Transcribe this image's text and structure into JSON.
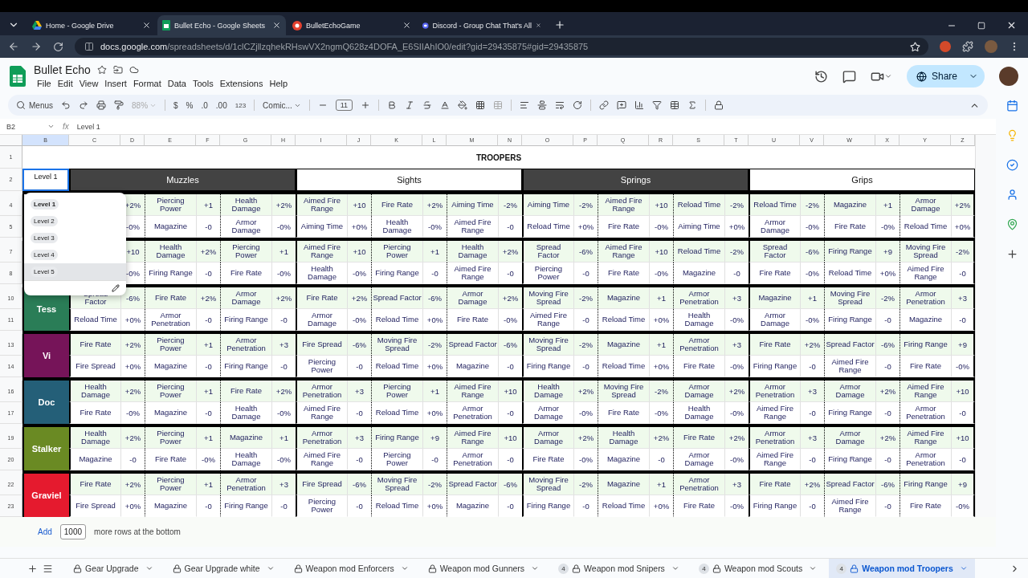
{
  "browser": {
    "tabs": [
      {
        "title": "Home - Google Drive",
        "kind": "drive",
        "selected": false
      },
      {
        "title": "Bullet Echo - Google Sheets",
        "kind": "sheets",
        "selected": true
      },
      {
        "title": "BulletEchoGame",
        "kind": "game",
        "selected": false
      },
      {
        "title": "Discord - Group Chat That's All",
        "kind": "discord",
        "selected": false
      }
    ],
    "url": {
      "host": "docs.google.com",
      "path": "/spreadsheets/d/1clCZjllzqhekRHswVX2ngmQ628z4DOFA_E6SIIAhIO0/edit?gid=29435875#gid=29435875"
    }
  },
  "doc": {
    "title": "Bullet Echo",
    "menus": [
      "File",
      "Edit",
      "View",
      "Insert",
      "Format",
      "Data",
      "Tools",
      "Extensions",
      "Help"
    ],
    "share": "Share"
  },
  "toolbar": {
    "search": "Menus",
    "zoom": "88%",
    "currency": "$",
    "percent": "%",
    "decrease_decimals": ".0",
    "increase_decimals": ".00",
    "number_format": "123",
    "font": "Comic...",
    "font_size": "11"
  },
  "formula_bar": {
    "cell_ref": "B2",
    "fx": "fx",
    "content": "Level 1"
  },
  "columns": [
    {
      "letter": "B",
      "selected": true
    },
    {
      "letter": "C",
      "selected": false
    },
    {
      "letter": "D",
      "selected": false
    },
    {
      "letter": "E",
      "selected": false
    },
    {
      "letter": "F",
      "selected": false
    },
    {
      "letter": "G",
      "selected": false
    },
    {
      "letter": "H",
      "selected": false
    },
    {
      "letter": "I",
      "selected": false
    },
    {
      "letter": "J",
      "selected": false
    },
    {
      "letter": "K",
      "selected": false
    },
    {
      "letter": "L",
      "selected": false
    },
    {
      "letter": "M",
      "selected": false
    },
    {
      "letter": "N",
      "selected": false
    },
    {
      "letter": "O",
      "selected": false
    },
    {
      "letter": "P",
      "selected": false
    },
    {
      "letter": "Q",
      "selected": false
    },
    {
      "letter": "R",
      "selected": false
    },
    {
      "letter": "S",
      "selected": false
    },
    {
      "letter": "T",
      "selected": false
    },
    {
      "letter": "U",
      "selected": false
    },
    {
      "letter": "V",
      "selected": false
    },
    {
      "letter": "W",
      "selected": false
    },
    {
      "letter": "X",
      "selected": false
    },
    {
      "letter": "Y",
      "selected": false
    },
    {
      "letter": "Z",
      "selected": false
    }
  ],
  "title_row": {
    "number": "1",
    "text": "TROOPERS"
  },
  "header_row": {
    "number": "2",
    "level_cell": "Level 1",
    "groups": [
      {
        "name": "Muzzles",
        "dark": true
      },
      {
        "name": "Sights",
        "dark": false
      },
      {
        "name": "Springs",
        "dark": true
      },
      {
        "name": "Grips",
        "dark": false
      }
    ]
  },
  "characters": [
    {
      "rows": [
        {
          "number": "4",
          "cells": [
            {
              "value": "+2%"
            },
            {
              "stat": "Piercing Power",
              "value": "+1"
            },
            {
              "stat": "Health Damage",
              "value": "+2%"
            },
            {
              "stat": "Aimed Fire Range",
              "value": "+10"
            },
            {
              "stat": "Fire Rate",
              "value": "+2%"
            },
            {
              "stat": "Aiming Time",
              "value": "-2%"
            },
            {
              "stat": "Aiming Time",
              "value": "-2%"
            },
            {
              "stat": "Aimed Fire Range",
              "value": "+10"
            },
            {
              "stat": "Reload Time",
              "value": "-2%"
            },
            {
              "stat": "Reload Time",
              "value": "-2%"
            },
            {
              "stat": "Magazine",
              "value": "+1"
            },
            {
              "stat": "Armor Damage",
              "value": "+2%"
            }
          ]
        },
        {
          "number": "5",
          "cells": [
            {
              "value": "-0%"
            },
            {
              "stat": "Magazine",
              "value": "-0"
            },
            {
              "stat": "Armor Damage",
              "value": "-0%"
            },
            {
              "stat": "Aiming Time",
              "value": "+0%"
            },
            {
              "stat": "Health Damage",
              "value": "-0%"
            },
            {
              "stat": "Aimed Fire Range",
              "value": "-0"
            },
            {
              "stat": "Reload Time",
              "value": "+0%"
            },
            {
              "stat": "Fire Rate",
              "value": "-0%"
            },
            {
              "stat": "Aiming Time",
              "value": "+0%"
            },
            {
              "stat": "Armor Damage",
              "value": "-0%"
            },
            {
              "stat": "Fire Rate",
              "value": "-0%"
            },
            {
              "stat": "Reload Time",
              "value": "+0%"
            }
          ]
        }
      ]
    },
    {
      "rows": [
        {
          "number": "7",
          "cells": [
            {
              "value": "+10"
            },
            {
              "stat": "Health Damage",
              "value": "+2%"
            },
            {
              "stat": "Piercing Power",
              "value": "+1"
            },
            {
              "stat": "Aimed Fire Range",
              "value": "+10"
            },
            {
              "stat": "Piercing Power",
              "value": "+1"
            },
            {
              "stat": "Health Damage",
              "value": "+2%"
            },
            {
              "stat": "Spread Factor",
              "value": "-6%"
            },
            {
              "stat": "Aimed Fire Range",
              "value": "+10"
            },
            {
              "stat": "Reload Time",
              "value": "-2%"
            },
            {
              "stat": "Spread Factor",
              "value": "-6%"
            },
            {
              "stat": "Firing Range",
              "value": "+9"
            },
            {
              "stat": "Moving Fire Spread",
              "value": "-2%"
            }
          ]
        },
        {
          "number": "8",
          "cells": [
            {
              "value": "-0%"
            },
            {
              "stat": "Firing Range",
              "value": "-0"
            },
            {
              "stat": "Fire Rate",
              "value": "-0%"
            },
            {
              "stat": "Health Damage",
              "value": "-0%"
            },
            {
              "stat": "Firing Range",
              "value": "-0"
            },
            {
              "stat": "Aimed Fire Range",
              "value": "-0"
            },
            {
              "stat": "Piercing Power",
              "value": "-0"
            },
            {
              "stat": "Fire Rate",
              "value": "-0%"
            },
            {
              "stat": "Magazine",
              "value": "-0"
            },
            {
              "stat": "Fire Rate",
              "value": "-0%"
            },
            {
              "stat": "Reload Time",
              "value": "+0%"
            },
            {
              "stat": "Aimed Fire Range",
              "value": "-0"
            }
          ]
        }
      ]
    },
    {
      "name": "Tess",
      "color": "#2a7d57",
      "rows": [
        {
          "number": "10",
          "cells": [
            {
              "stat": "Spread Factor",
              "value": "-6%"
            },
            {
              "stat": "Fire Rate",
              "value": "+2%"
            },
            {
              "stat": "Armor Damage",
              "value": "+2%"
            },
            {
              "stat": "Fire Rate",
              "value": "+2%"
            },
            {
              "stat": "Spread Factor",
              "value": "-6%"
            },
            {
              "stat": "Armor Damage",
              "value": "+2%"
            },
            {
              "stat": "Moving Fire Spread",
              "value": "-2%"
            },
            {
              "stat": "Magazine",
              "value": "+1"
            },
            {
              "stat": "Armor Penetration",
              "value": "+3"
            },
            {
              "stat": "Magazine",
              "value": "+1"
            },
            {
              "stat": "Moving Fire Spread",
              "value": "-2%"
            },
            {
              "stat": "Armor Penetration",
              "value": "+3"
            }
          ]
        },
        {
          "number": "11",
          "cells": [
            {
              "stat": "Reload Time",
              "value": "+0%"
            },
            {
              "stat": "Armor Penetration",
              "value": "-0"
            },
            {
              "stat": "Firing Range",
              "value": "-0"
            },
            {
              "stat": "Armor Damage",
              "value": "-0%"
            },
            {
              "stat": "Reload Time",
              "value": "+0%"
            },
            {
              "stat": "Fire Rate",
              "value": "-0%"
            },
            {
              "stat": "Aimed Fire Range",
              "value": "-0"
            },
            {
              "stat": "Reload Time",
              "value": "+0%"
            },
            {
              "stat": "Health Damage",
              "value": "-0%"
            },
            {
              "stat": "Armor Damage",
              "value": "-0%"
            },
            {
              "stat": "Firing Range",
              "value": "-0"
            },
            {
              "stat": "Magazine",
              "value": "-0"
            }
          ]
        }
      ]
    },
    {
      "name": "Vi",
      "color": "#761459",
      "rows": [
        {
          "number": "13",
          "cells": [
            {
              "stat": "Fire Rate",
              "value": "+2%"
            },
            {
              "stat": "Piercing Power",
              "value": "+1"
            },
            {
              "stat": "Armor Penetration",
              "value": "+3"
            },
            {
              "stat": "Fire Spread",
              "value": "-6%"
            },
            {
              "stat": "Moving Fire Spread",
              "value": "-2%"
            },
            {
              "stat": "Spread Factor",
              "value": "-6%"
            },
            {
              "stat": "Moving Fire Spread",
              "value": "-2%"
            },
            {
              "stat": "Magazine",
              "value": "+1"
            },
            {
              "stat": "Armor Penetration",
              "value": "+3"
            },
            {
              "stat": "Fire Rate",
              "value": "+2%"
            },
            {
              "stat": "Spread Factor",
              "value": "-6%"
            },
            {
              "stat": "Firing Range",
              "value": "+9"
            }
          ]
        },
        {
          "number": "14",
          "cells": [
            {
              "stat": "Fire Spread",
              "value": "+0%"
            },
            {
              "stat": "Magazine",
              "value": "-0"
            },
            {
              "stat": "Firing Range",
              "value": "-0"
            },
            {
              "stat": "Piercing Power",
              "value": "-0"
            },
            {
              "stat": "Reload Time",
              "value": "+0%"
            },
            {
              "stat": "Magazine",
              "value": "-0"
            },
            {
              "stat": "Firing Range",
              "value": "-0"
            },
            {
              "stat": "Reload Time",
              "value": "+0%"
            },
            {
              "stat": "Fire Rate",
              "value": "-0%"
            },
            {
              "stat": "Firing Range",
              "value": "-0"
            },
            {
              "stat": "Aimed Fire Range",
              "value": "-0"
            },
            {
              "stat": "Fire Rate",
              "value": "-0%"
            }
          ]
        }
      ]
    },
    {
      "name": "Doc",
      "color": "#245f78",
      "rows": [
        {
          "number": "16",
          "cells": [
            {
              "stat": "Health Damage",
              "value": "+2%"
            },
            {
              "stat": "Piercing Power",
              "value": "+1"
            },
            {
              "stat": "Fire Rate",
              "value": "+2%"
            },
            {
              "stat": "Armor Penetration",
              "value": "+3"
            },
            {
              "stat": "Piercing Power",
              "value": "+1"
            },
            {
              "stat": "Aimed Fire Range",
              "value": "+10"
            },
            {
              "stat": "Health Damage",
              "value": "+2%"
            },
            {
              "stat": "Moving Fire Spread",
              "value": "-2%"
            },
            {
              "stat": "Armor Damage",
              "value": "+2%"
            },
            {
              "stat": "Armor Penetration",
              "value": "+3"
            },
            {
              "stat": "Armor Damage",
              "value": "+2%"
            },
            {
              "stat": "Aimed Fire Range",
              "value": "+10"
            }
          ]
        },
        {
          "number": "17",
          "cells": [
            {
              "stat": "Fire Rate",
              "value": "-0%"
            },
            {
              "stat": "Magazine",
              "value": "-0"
            },
            {
              "stat": "Health Damage",
              "value": "-0%"
            },
            {
              "stat": "Aimed Fire Range",
              "value": "-0"
            },
            {
              "stat": "Reload Time",
              "value": "+0%"
            },
            {
              "stat": "Armor Penetration",
              "value": "-0"
            },
            {
              "stat": "Armor Damage",
              "value": "-0%"
            },
            {
              "stat": "Fire Rate",
              "value": "-0%"
            },
            {
              "stat": "Health Damage",
              "value": "-0%"
            },
            {
              "stat": "Aimed Fire Range",
              "value": "-0"
            },
            {
              "stat": "Firing Range",
              "value": "-0"
            },
            {
              "stat": "Armor Penetration",
              "value": "-0"
            }
          ]
        }
      ]
    },
    {
      "name": "Stalker",
      "color": "#6a8a23",
      "rows": [
        {
          "number": "19",
          "cells": [
            {
              "stat": "Health Damage",
              "value": "+2%"
            },
            {
              "stat": "Piercing Power",
              "value": "+1"
            },
            {
              "stat": "Magazine",
              "value": "+1"
            },
            {
              "stat": "Armor Penetration",
              "value": "+3"
            },
            {
              "stat": "Firing Range",
              "value": "+9"
            },
            {
              "stat": "Aimed Fire Range",
              "value": "+10"
            },
            {
              "stat": "Armor Damage",
              "value": "+2%"
            },
            {
              "stat": "Health Damage",
              "value": "+2%"
            },
            {
              "stat": "Fire Rate",
              "value": "+2%"
            },
            {
              "stat": "Armor Penetration",
              "value": "+3"
            },
            {
              "stat": "Armor Damage",
              "value": "+2%"
            },
            {
              "stat": "Aimed Fire Range",
              "value": "+10"
            }
          ]
        },
        {
          "number": "20",
          "cells": [
            {
              "stat": "Magazine",
              "value": "-0"
            },
            {
              "stat": "Fire Rate",
              "value": "-0%"
            },
            {
              "stat": "Health Damage",
              "value": "-0%"
            },
            {
              "stat": "Aimed Fire Range",
              "value": "-0"
            },
            {
              "stat": "Piercing Power",
              "value": "-0"
            },
            {
              "stat": "Armor Penetration",
              "value": "-0"
            },
            {
              "stat": "Fire Rate",
              "value": "-0%"
            },
            {
              "stat": "Magazine",
              "value": "-0"
            },
            {
              "stat": "Armor Damage",
              "value": "-0%"
            },
            {
              "stat": "Aimed Fire Range",
              "value": "-0"
            },
            {
              "stat": "Firing Range",
              "value": "-0"
            },
            {
              "stat": "Armor Penetration",
              "value": "-0"
            }
          ]
        }
      ]
    },
    {
      "name": "Graviel",
      "color": "#e51a2e",
      "rows": [
        {
          "number": "22",
          "cells": [
            {
              "stat": "Fire Rate",
              "value": "+2%"
            },
            {
              "stat": "Piercing Power",
              "value": "+1"
            },
            {
              "stat": "Armor Penetration",
              "value": "+3"
            },
            {
              "stat": "Fire Spread",
              "value": "-6%"
            },
            {
              "stat": "Moving Fire Spread",
              "value": "-2%"
            },
            {
              "stat": "Spread Factor",
              "value": "-6%"
            },
            {
              "stat": "Moving Fire Spread",
              "value": "-2%"
            },
            {
              "stat": "Magazine",
              "value": "+1"
            },
            {
              "stat": "Armor Penetration",
              "value": "+3"
            },
            {
              "stat": "Fire Rate",
              "value": "+2%"
            },
            {
              "stat": "Spread Factor",
              "value": "-6%"
            },
            {
              "stat": "Firing Range",
              "value": "+9"
            }
          ]
        },
        {
          "number": "23",
          "cells": [
            {
              "stat": "Fire Spread",
              "value": "+0%"
            },
            {
              "stat": "Magazine",
              "value": "-0"
            },
            {
              "stat": "Firing Range",
              "value": "-0"
            },
            {
              "stat": "Piercing Power",
              "value": "-0"
            },
            {
              "stat": "Reload Time",
              "value": "+0%"
            },
            {
              "stat": "Magazine",
              "value": "-0"
            },
            {
              "stat": "Firing Range",
              "value": "-0"
            },
            {
              "stat": "Reload Time",
              "value": "+0%"
            },
            {
              "stat": "Fire Rate",
              "value": "-0%"
            },
            {
              "stat": "Firing Range",
              "value": "-0"
            },
            {
              "stat": "Aimed Fire Range",
              "value": "-0"
            },
            {
              "stat": "Fire Rate",
              "value": "-0%"
            }
          ]
        }
      ]
    }
  ],
  "dropdown": {
    "options": [
      {
        "label": "Level 1",
        "selected": true,
        "hovered": false
      },
      {
        "label": "Level 2",
        "selected": false,
        "hovered": false
      },
      {
        "label": "Level 3",
        "selected": false,
        "hovered": false
      },
      {
        "label": "Level 4",
        "selected": false,
        "hovered": false
      },
      {
        "label": "Level 5",
        "selected": false,
        "hovered": true
      }
    ]
  },
  "add_rows": {
    "button": "Add",
    "count": "1000",
    "suffix": "more rows at the bottom"
  },
  "sheet_tabs": [
    {
      "name": "Gear Upgrade",
      "selected": false
    },
    {
      "name": "Gear Upgrade white",
      "selected": false
    },
    {
      "name": "Weapon mod Enforcers",
      "selected": false
    },
    {
      "name": "Weapon mod Gunners",
      "selected": false
    },
    {
      "name": "Weapon mod Snipers",
      "badge": "4",
      "selected": false
    },
    {
      "name": "Weapon mod Scouts",
      "badge": "4",
      "selected": false
    },
    {
      "name": "Weapon mod Troopers",
      "badge": "4",
      "selected": true
    }
  ]
}
